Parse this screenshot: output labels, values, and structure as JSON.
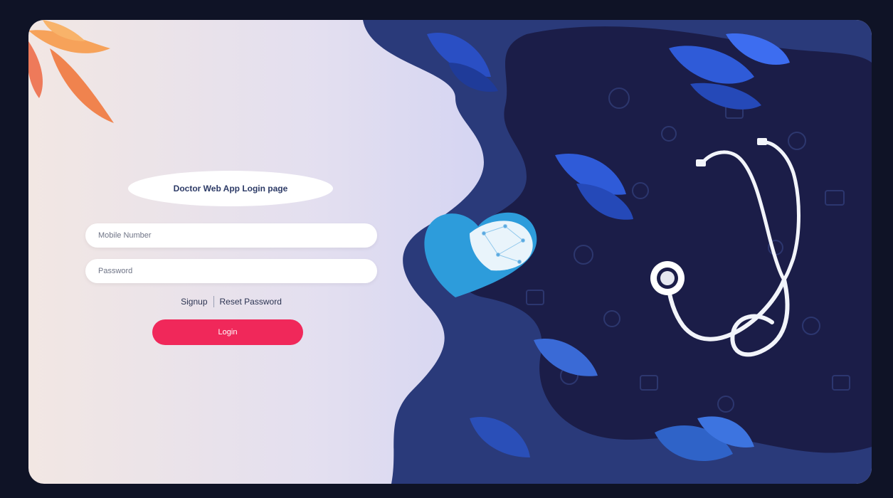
{
  "login": {
    "title": "Doctor Web App Login page",
    "mobile_placeholder": "Mobile Number",
    "password_placeholder": "Password",
    "signup_label": "Signup",
    "reset_label": "Reset Password",
    "login_label": "Login"
  },
  "colors": {
    "accent": "#f0285a",
    "panel_dark": "#1b1d48",
    "leaf_blue": "#2f5bd8",
    "heart_blue": "#2d9cdb"
  }
}
